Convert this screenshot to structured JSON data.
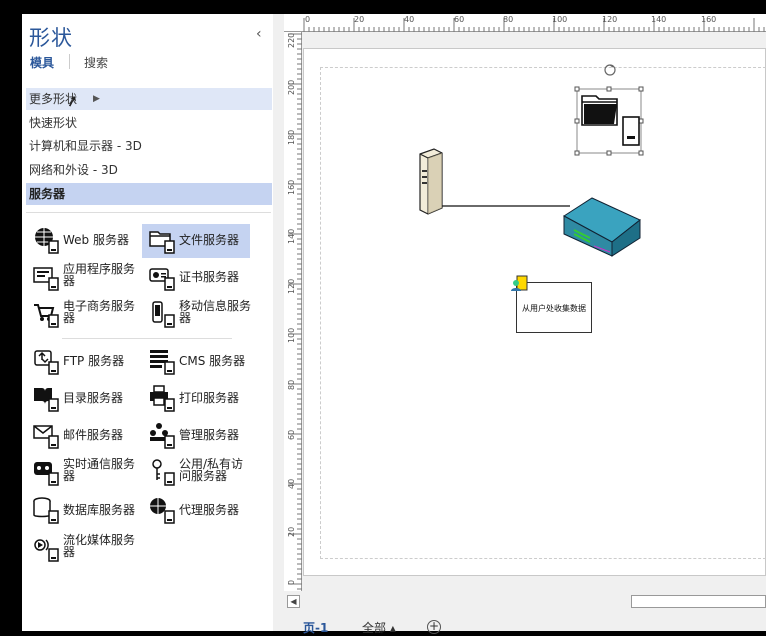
{
  "pane": {
    "title": "形状",
    "collapse_glyph": "‹",
    "tabs": {
      "stencils": "模具",
      "search": "搜索"
    },
    "menu": [
      {
        "label": "更多形状",
        "state": "hover",
        "has_arrow": true
      },
      {
        "label": "快速形状",
        "state": "normal"
      },
      {
        "label": "计算机和显示器 - 3D",
        "state": "normal"
      },
      {
        "label": "网络和外设 - 3D",
        "state": "normal"
      },
      {
        "label": "服务器",
        "state": "selected"
      }
    ],
    "shapes": [
      {
        "label": "Web 服务器",
        "icon": "globe-server-icon"
      },
      {
        "label": "文件服务器",
        "icon": "folder-server-icon",
        "selected": true
      },
      {
        "label": "应用程序服务器",
        "icon": "app-server-icon"
      },
      {
        "label": "证书服务器",
        "icon": "certificate-server-icon"
      },
      {
        "label": "电子商务服务器",
        "icon": "cart-server-icon"
      },
      {
        "label": "移动信息服务器",
        "icon": "mobile-server-icon"
      },
      {
        "label": "FTP 服务器",
        "icon": "ftp-server-icon"
      },
      {
        "label": "CMS 服务器",
        "icon": "cms-server-icon"
      },
      {
        "label": "目录服务器",
        "icon": "directory-server-icon"
      },
      {
        "label": "打印服务器",
        "icon": "print-server-icon"
      },
      {
        "label": "邮件服务器",
        "icon": "mail-server-icon"
      },
      {
        "label": "管理服务器",
        "icon": "management-server-icon"
      },
      {
        "label": "实时通信服务器",
        "icon": "im-server-icon"
      },
      {
        "label": "公用/私有访问服务器",
        "icon": "key-server-icon"
      },
      {
        "label": "数据库服务器",
        "icon": "database-server-icon"
      },
      {
        "label": "代理服务器",
        "icon": "proxy-server-icon"
      },
      {
        "label": "流化媒体服务器",
        "icon": "streaming-server-icon"
      }
    ]
  },
  "ruler": {
    "top": [
      "0",
      "20",
      "40",
      "60",
      "80",
      "100",
      "120",
      "140",
      "160"
    ],
    "left": [
      "220",
      "200",
      "180",
      "160",
      "140",
      "120",
      "100",
      "80",
      "60",
      "40",
      "20",
      "0"
    ]
  },
  "canvas": {
    "note_text": "从用户处收集数据"
  },
  "page_tabs": {
    "page1": "页-1",
    "all": "全部",
    "all_arrow": "▴",
    "add": "+"
  },
  "colors": {
    "accent": "#2b579a",
    "selected_bg": "#c5d3f1",
    "hover_bg": "#dfe7f7",
    "router_blue": "#2f8aa3"
  }
}
